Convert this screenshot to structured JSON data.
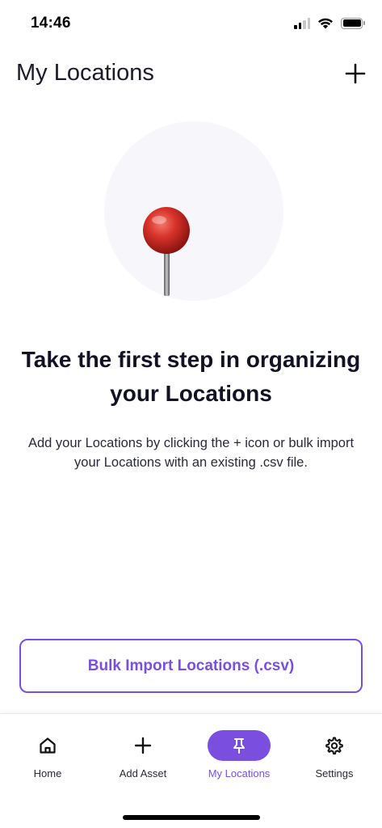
{
  "status_bar": {
    "time": "14:46",
    "icons": [
      "signal-icon",
      "wifi-icon",
      "battery-icon"
    ]
  },
  "header": {
    "title": "My Locations",
    "add_icon": "plus-icon"
  },
  "illustration": {
    "icon": "push-pin-icon"
  },
  "empty_state": {
    "headline": "Take the first step in organizing your Locations",
    "description": "Add your Locations by clicking the + icon or bulk import your Locations with an existing .csv file."
  },
  "bulk_import": {
    "label": "Bulk Import Locations (.csv)"
  },
  "nav": {
    "items": [
      {
        "label": "Home",
        "icon": "home-icon",
        "active": false
      },
      {
        "label": "Add Asset",
        "icon": "plus-icon",
        "active": false
      },
      {
        "label": "My Locations",
        "icon": "pin-icon",
        "active": true
      },
      {
        "label": "Settings",
        "icon": "gear-icon",
        "active": false
      }
    ]
  },
  "colors": {
    "accent": "#7a4fe0",
    "text": "#121224",
    "pin_red": "#d42a24"
  }
}
